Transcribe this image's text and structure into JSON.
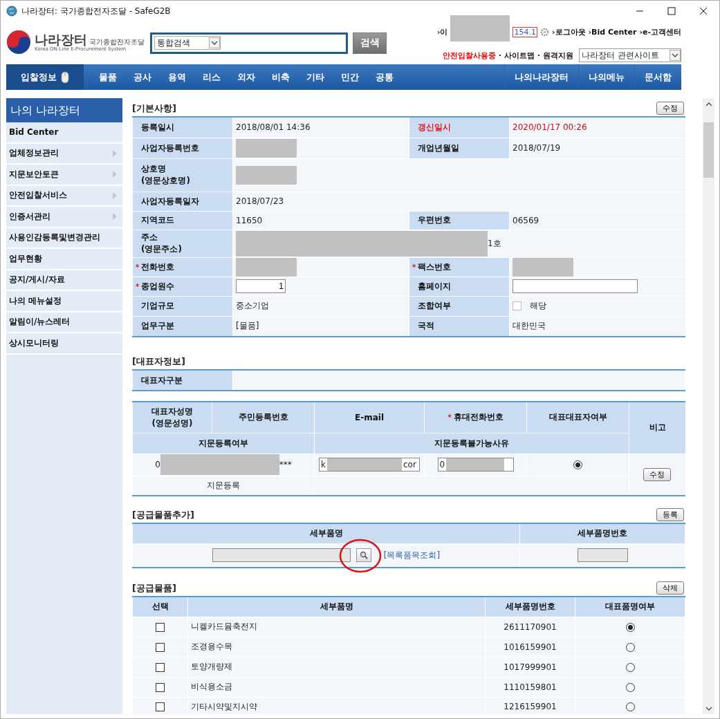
{
  "window": {
    "title": "나라장터: 국가종합전자조달 - SafeG2B"
  },
  "header": {
    "logo_title": "나라장터",
    "logo_subtitle": "국가종합전자조달",
    "logo_english": "Korea ON-Line E-Procurement System",
    "search_scope": "통합검색",
    "search_button": "검색",
    "user_prefix": "›이",
    "user_ip": "154.1",
    "links": [
      "›로그아웃",
      "›Bid Center",
      "›e-고객센터"
    ],
    "safe_notice": "안전입찰사용중",
    "sub_links": [
      {
        "separator": "·",
        "label": "사이트맵"
      },
      {
        "separator": "·",
        "label": "원격지원"
      }
    ],
    "related_select": "나라장터 관련사이트"
  },
  "nav": {
    "primary": "입찰정보",
    "items": [
      "물품",
      "공사",
      "용역",
      "리스",
      "외자",
      "비축",
      "기타",
      "민간",
      "공통"
    ],
    "right_items": [
      "나의나라장터",
      "나의메뉴",
      "문서함"
    ]
  },
  "sidebar": {
    "title": "나의 나라장터",
    "items": [
      {
        "label": "Bid Center",
        "has_submenu": false
      },
      {
        "label": "업체정보관리",
        "has_submenu": true
      },
      {
        "label": "지문보안토큰",
        "has_submenu": true
      },
      {
        "label": "안전입찰서비스",
        "has_submenu": true
      },
      {
        "label": "인증서관리",
        "has_submenu": true
      },
      {
        "label": "사용인감등록및변경관리",
        "has_submenu": false
      },
      {
        "label": "업무현황",
        "has_submenu": false
      },
      {
        "label": "공지/게시/자료",
        "has_submenu": false
      },
      {
        "label": "나의 메뉴설정",
        "has_submenu": false
      },
      {
        "label": "알림이/뉴스레터",
        "has_submenu": false
      },
      {
        "label": "상시모니터링",
        "has_submenu": false
      }
    ]
  },
  "basic": {
    "title": "[기본사항]",
    "edit_button": "수정",
    "rows": [
      {
        "items": [
          {
            "label": "등록일시",
            "alert": false,
            "field": {
              "kind": "text",
              "value": "2018/08/01 14:36"
            }
          },
          {
            "label": "갱신일시",
            "alert": true,
            "field": {
              "kind": "text",
              "value": "2020/01/17 00:26"
            }
          }
        ]
      },
      {
        "items": [
          {
            "label": "사업자등록번호",
            "alert": false,
            "field": {
              "kind": "redacted"
            }
          },
          {
            "label": "개업년월일",
            "alert": false,
            "field": {
              "kind": "text",
              "value": "2018/07/19"
            }
          }
        ]
      },
      {
        "items": [
          {
            "label": "상호명\n(영문상호명)",
            "alert": false,
            "field": {
              "kind": "redacted"
            }
          }
        ]
      },
      {
        "items": [
          {
            "label": "사업자등록일자",
            "alert": false,
            "field": {
              "kind": "text",
              "value": "2018/07/23"
            }
          }
        ]
      },
      {
        "items": [
          {
            "label": "지역코드",
            "alert": false,
            "field": {
              "kind": "text",
              "value": "11650"
            }
          },
          {
            "label": "우편번호",
            "alert": false,
            "field": {
              "kind": "text",
              "value": "06569"
            }
          }
        ]
      },
      {
        "items": [
          {
            "label": "주소\n(영문주소)",
            "alert": false,
            "field": {
              "kind": "redacted_wide",
              "value": "1호"
            }
          }
        ]
      },
      {
        "items": [
          {
            "required_mark": "*",
            "label": "전화번호",
            "alert": false,
            "field": {
              "kind": "redacted"
            }
          },
          {
            "required_mark": "*",
            "label": "팩스번호",
            "alert": false,
            "field": {
              "kind": "redacted"
            }
          }
        ]
      },
      {
        "items": [
          {
            "required_mark": "*",
            "label": "종업원수",
            "alert": false,
            "field": {
              "kind": "input",
              "value": "1"
            }
          },
          {
            "label": "홈페이지",
            "alert": false,
            "field": {
              "kind": "input_wide"
            }
          }
        ]
      },
      {
        "items": [
          {
            "label": "기업규모",
            "alert": false,
            "field": {
              "kind": "text",
              "value": "중소기업"
            }
          },
          {
            "label": "조합여부",
            "alert": false,
            "field": {
              "kind": "checkbox",
              "value": "해당",
              "checked": false
            }
          }
        ]
      },
      {
        "items": [
          {
            "label": "업무구분",
            "alert": false,
            "field": {
              "kind": "text",
              "value": "[물품]"
            }
          },
          {
            "label": "국적",
            "alert": false,
            "field": {
              "kind": "text",
              "value": "대한민국"
            }
          }
        ]
      }
    ]
  },
  "representative": {
    "title": "[대표자정보]",
    "type_label": "대표자구분",
    "columns": [
      {
        "label": "대표자성명\n(영문성명)"
      },
      {
        "label": "주민등록번호"
      },
      {
        "label": "E-mail"
      },
      {
        "required_mark": "*",
        "label": "휴대전화번호"
      },
      {
        "label": "대표대표자여부"
      },
      {
        "label": "비고"
      }
    ],
    "columns_second": [
      "지문등록여부",
      "지문등록불가능사유"
    ],
    "row": {
      "name_start": "0",
      "id_end": "***",
      "email_start": "k",
      "email_end": "cor",
      "mobile_start": "0",
      "selected": true,
      "fingerprint": "지문등록",
      "edit_button": "수정"
    }
  },
  "supply_add": {
    "title": "[공급물품추가]",
    "button": "등록",
    "columns": [
      "세부품명",
      "세부품명번호"
    ],
    "lookup_link": "[목록품목조회]"
  },
  "supply": {
    "title": "[공급물품]",
    "button": "삭제",
    "columns": [
      "선택",
      "세부품명",
      "세부품명번호",
      "대표품명여부"
    ],
    "rows": [
      {
        "checked": false,
        "name": "니켈카드뮴축전지",
        "code": "2611170901",
        "selected": true
      },
      {
        "checked": false,
        "name": "조경용수목",
        "code": "1016159901",
        "selected": false
      },
      {
        "checked": false,
        "name": "토양개량제",
        "code": "1017999901",
        "selected": false
      },
      {
        "checked": false,
        "name": "비식용소금",
        "code": "1110159801",
        "selected": false
      },
      {
        "checked": false,
        "name": "기타시약및지시약",
        "code": "1216159901",
        "selected": false
      }
    ]
  }
}
